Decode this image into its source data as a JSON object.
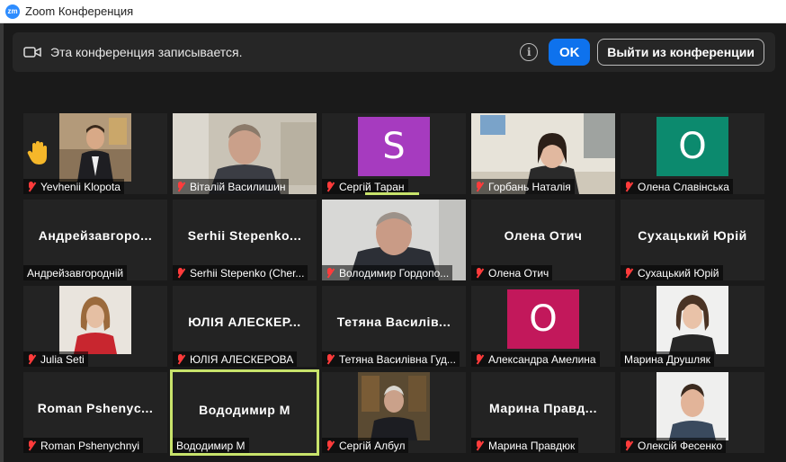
{
  "window": {
    "title": "Zoom Конференция"
  },
  "banner": {
    "message": "Эта конференция записывается.",
    "ok_label": "OK",
    "leave_label": "Выйти из конференции"
  },
  "tiles": [
    {
      "name": "Yevhenii Klopota",
      "bigname": "",
      "avatar_letter": "",
      "avatar_color": "",
      "kind": "photo"
    },
    {
      "name": "Віталій Василишин",
      "bigname": "",
      "avatar_letter": "",
      "avatar_color": "",
      "kind": "video"
    },
    {
      "name": "Сергій Таран",
      "bigname": "",
      "avatar_letter": "S",
      "avatar_color": "#a63bbf",
      "kind": "avatar"
    },
    {
      "name": "Горбань Наталія",
      "bigname": "",
      "avatar_letter": "",
      "avatar_color": "",
      "kind": "video"
    },
    {
      "name": "Олена Славінська",
      "bigname": "",
      "avatar_letter": "O",
      "avatar_color": "#0c8a6e",
      "kind": "avatar"
    },
    {
      "name": "Андрейзавгородній",
      "bigname": "Андрейзавгоро...",
      "avatar_letter": "",
      "avatar_color": "",
      "kind": "text"
    },
    {
      "name": "Serhii Stepenko (Cher...",
      "bigname": "Serhii  Stepenko...",
      "avatar_letter": "",
      "avatar_color": "",
      "kind": "text"
    },
    {
      "name": "Володимир Гордопо...",
      "bigname": "",
      "avatar_letter": "",
      "avatar_color": "",
      "kind": "video"
    },
    {
      "name": "Олена Отич",
      "bigname": "Олена Отич",
      "avatar_letter": "",
      "avatar_color": "",
      "kind": "text"
    },
    {
      "name": "Сухацький Юрій",
      "bigname": "Сухацький Юрій",
      "avatar_letter": "",
      "avatar_color": "",
      "kind": "text"
    },
    {
      "name": "Julia Seti",
      "bigname": "",
      "avatar_letter": "",
      "avatar_color": "",
      "kind": "photo"
    },
    {
      "name": "ЮЛІЯ АЛЕСКЕРОВА",
      "bigname": "ЮЛІЯ  АЛЕСКЕР...",
      "avatar_letter": "",
      "avatar_color": "",
      "kind": "text"
    },
    {
      "name": "Тетяна Василівна Гуд...",
      "bigname": "Тетяна  Василів...",
      "avatar_letter": "",
      "avatar_color": "",
      "kind": "text"
    },
    {
      "name": "Александра Амелина",
      "bigname": "",
      "avatar_letter": "O",
      "avatar_color": "#c2185b",
      "kind": "avatar"
    },
    {
      "name": "Марина Друшляк",
      "bigname": "",
      "avatar_letter": "",
      "avatar_color": "",
      "kind": "photo"
    },
    {
      "name": "Roman Pshenychnyi",
      "bigname": "Roman  Pshenyc...",
      "avatar_letter": "",
      "avatar_color": "",
      "kind": "text"
    },
    {
      "name": "Вододимир М",
      "bigname": "Вододимир М",
      "avatar_letter": "",
      "avatar_color": "",
      "kind": "text"
    },
    {
      "name": "Сергій Албул",
      "bigname": "",
      "avatar_letter": "",
      "avatar_color": "",
      "kind": "video"
    },
    {
      "name": "Марина Правдюк",
      "bigname": "Марина  Правд...",
      "avatar_letter": "",
      "avatar_color": "",
      "kind": "text"
    },
    {
      "name": "Олексій Фесенко",
      "bigname": "",
      "avatar_letter": "",
      "avatar_color": "",
      "kind": "photo"
    }
  ],
  "colors": {
    "accent": "#0e72ed",
    "active_speaker": "#c8e36b",
    "muted_mic": "#ff3b3b"
  }
}
